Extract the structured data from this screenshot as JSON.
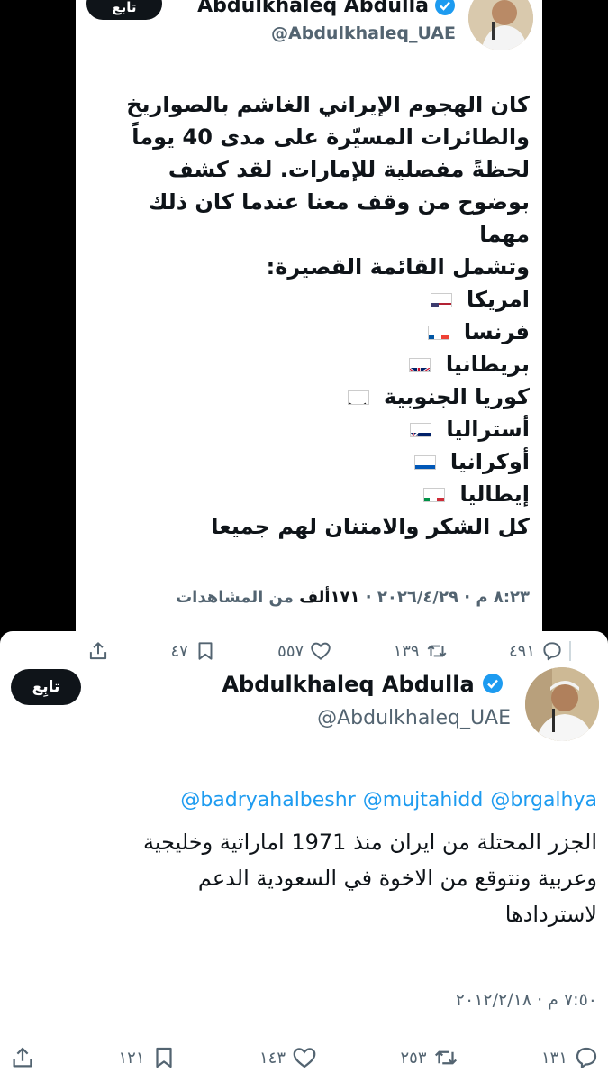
{
  "tweet1": {
    "follow_label": "تابع",
    "author_name": "Abdulkhaleq Abdulla",
    "author_handle": "@Abdulkhaleq_UAE",
    "body_lines": [
      "كان الهجوم الإيراني الغاشم بالصواريخ",
      "والطائرات المسيّرة على مدى 40 يوماً",
      "لحظةً مفصلية للإمارات. لقد كشف",
      "بوضوح من وقف معنا عندما كان ذلك",
      "مهما",
      "وتشمل القائمة القصيرة:"
    ],
    "countries": [
      {
        "name": "امريكا",
        "flag": "us-flag-icon"
      },
      {
        "name": "فرنسا",
        "flag": "fr-flag-icon"
      },
      {
        "name": "بريطانيا",
        "flag": "gb-flag-icon"
      },
      {
        "name": "كوريا الجنوبية",
        "flag": "kr-flag-icon"
      },
      {
        "name": "أستراليا",
        "flag": "au-flag-icon"
      },
      {
        "name": "أوكرانيا",
        "flag": "ua-flag-icon"
      },
      {
        "name": "إيطاليا",
        "flag": "it-flag-icon"
      }
    ],
    "closing_line": "كل الشكر والامتنان لهم جميعا",
    "timestamp": "٨:٢٣ م · ٢٠٢٦/٤/٢٩",
    "views_count": "١٧١ألف",
    "views_label": "من المشاهدات",
    "actions": {
      "replies": "٤٩١",
      "retweets": "١٣٩",
      "likes": "٥٥٧",
      "bookmarks": "٤٧"
    }
  },
  "tweet2": {
    "follow_label": "تابِع",
    "author_name": "Abdulkhaleq Abdulla",
    "author_handle": "@Abdulkhaleq_UAE",
    "mentions": [
      "@badryahalbeshr",
      "@mujtahidd",
      "@brgalhya"
    ],
    "body_lines": [
      "الجزر المحتلة من ايران منذ 1971  اماراتية وخليجية",
      "وعربية ونتوقع من الاخوة في السعودية الدعم",
      "لاستردادها"
    ],
    "timestamp": "٧:٥٠ م · ٢٠١٢/٢/١٨",
    "actions": {
      "replies": "١٣١",
      "retweets": "٢٥٣",
      "likes": "١٤٣",
      "bookmarks": "١٢١"
    }
  },
  "colors": {
    "accent": "#1d9bf0",
    "text": "#0f1419",
    "muted": "#536471",
    "background": "#000000"
  }
}
